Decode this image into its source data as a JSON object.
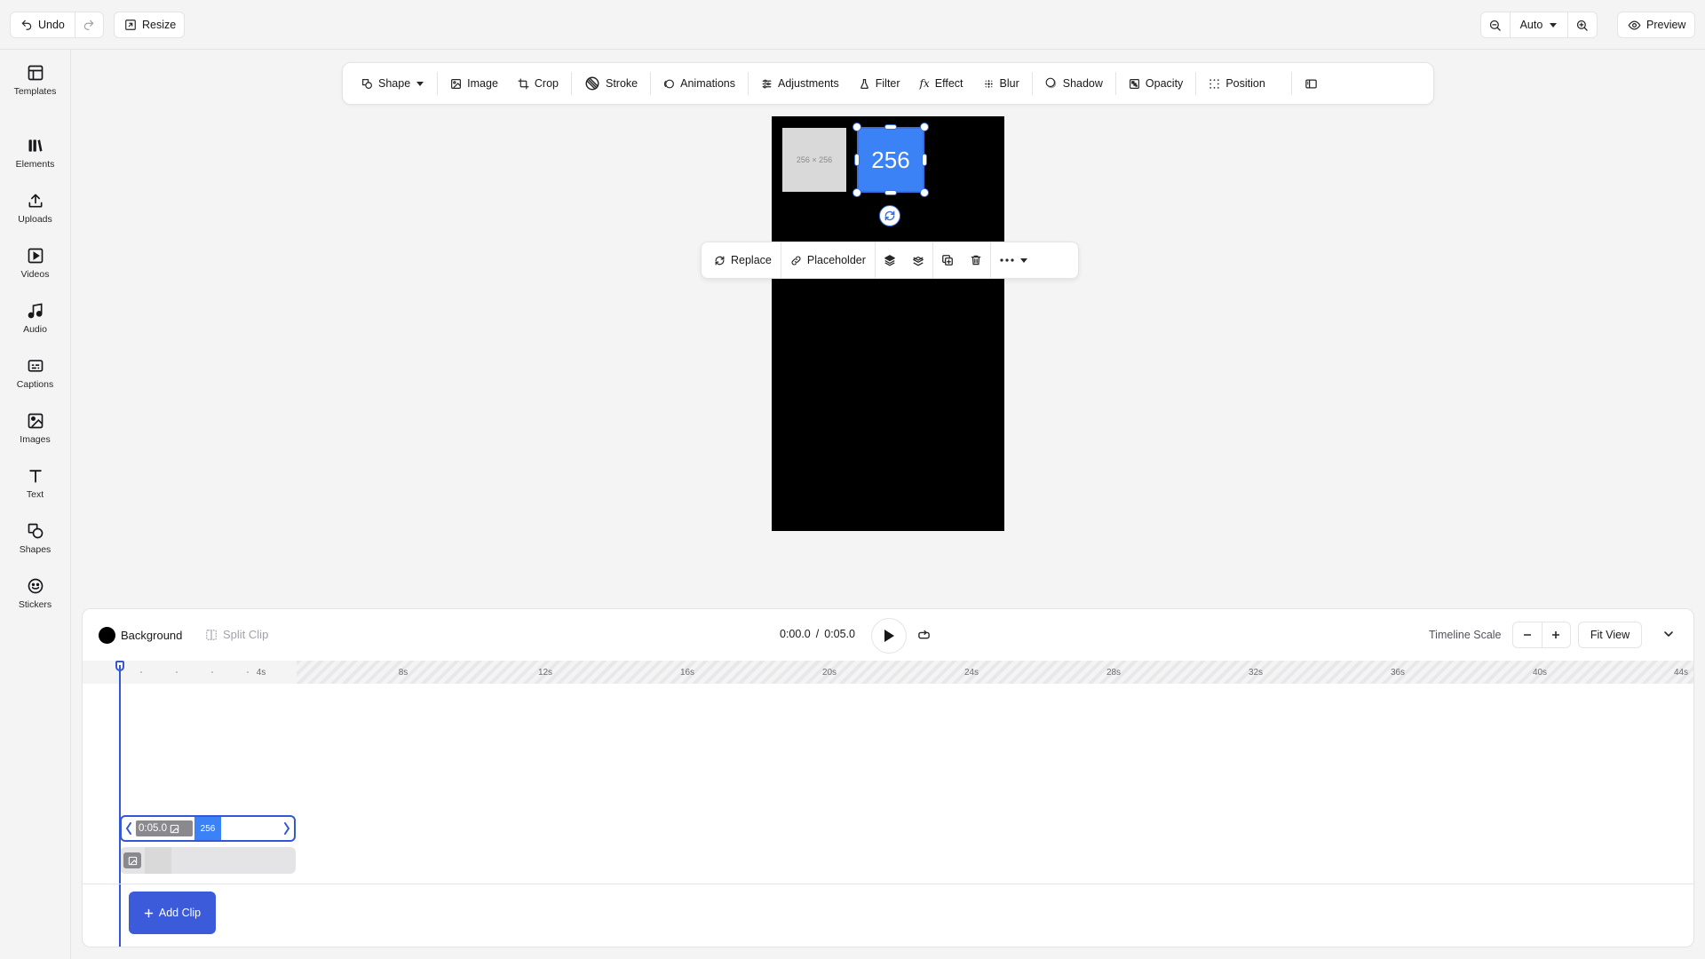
{
  "topbar": {
    "undo_label": "Undo",
    "resize_label": "Resize",
    "zoom_value": "Auto",
    "preview_label": "Preview"
  },
  "sidebar": {
    "items": [
      {
        "label": "Templates",
        "icon": "templates-icon"
      },
      {
        "label": "Elements",
        "icon": "elements-icon"
      },
      {
        "label": "Uploads",
        "icon": "upload-icon"
      },
      {
        "label": "Videos",
        "icon": "video-icon"
      },
      {
        "label": "Audio",
        "icon": "music-note-icon"
      },
      {
        "label": "Captions",
        "icon": "captions-icon"
      },
      {
        "label": "Images",
        "icon": "image-icon"
      },
      {
        "label": "Text",
        "icon": "text-icon"
      },
      {
        "label": "Shapes",
        "icon": "shapes-icon"
      },
      {
        "label": "Stickers",
        "icon": "sticker-icon"
      }
    ]
  },
  "toolbar": {
    "shape": "Shape",
    "image": "Image",
    "crop": "Crop",
    "stroke": "Stroke",
    "animations": "Animations",
    "adjustments": "Adjustments",
    "filter": "Filter",
    "effect": "Effect",
    "blur": "Blur",
    "shadow": "Shadow",
    "opacity": "Opacity",
    "position": "Position"
  },
  "canvas": {
    "placeholder_text": "256 × 256",
    "shape_text": "256"
  },
  "context_menu": {
    "replace": "Replace",
    "placeholder": "Placeholder"
  },
  "timeline": {
    "background_label": "Background",
    "split_clip_label": "Split Clip",
    "current_time": "0:00.0",
    "separator": "/",
    "total_time": "0:05.0",
    "scale_label": "Timeline Scale",
    "fit_view_label": "Fit View",
    "ruler_ticks": [
      "4s",
      "8s",
      "12s",
      "16s",
      "20s",
      "24s",
      "28s",
      "32s",
      "36s",
      "40s",
      "44s"
    ],
    "clip": {
      "duration": "0:05.0",
      "label": "256"
    },
    "add_clip_label": "Add Clip"
  },
  "colors": {
    "accent": "#3b5bdb",
    "selection": "#3457d5",
    "shape_fill": "#3b82f6",
    "canvas_bg": "#000000"
  }
}
